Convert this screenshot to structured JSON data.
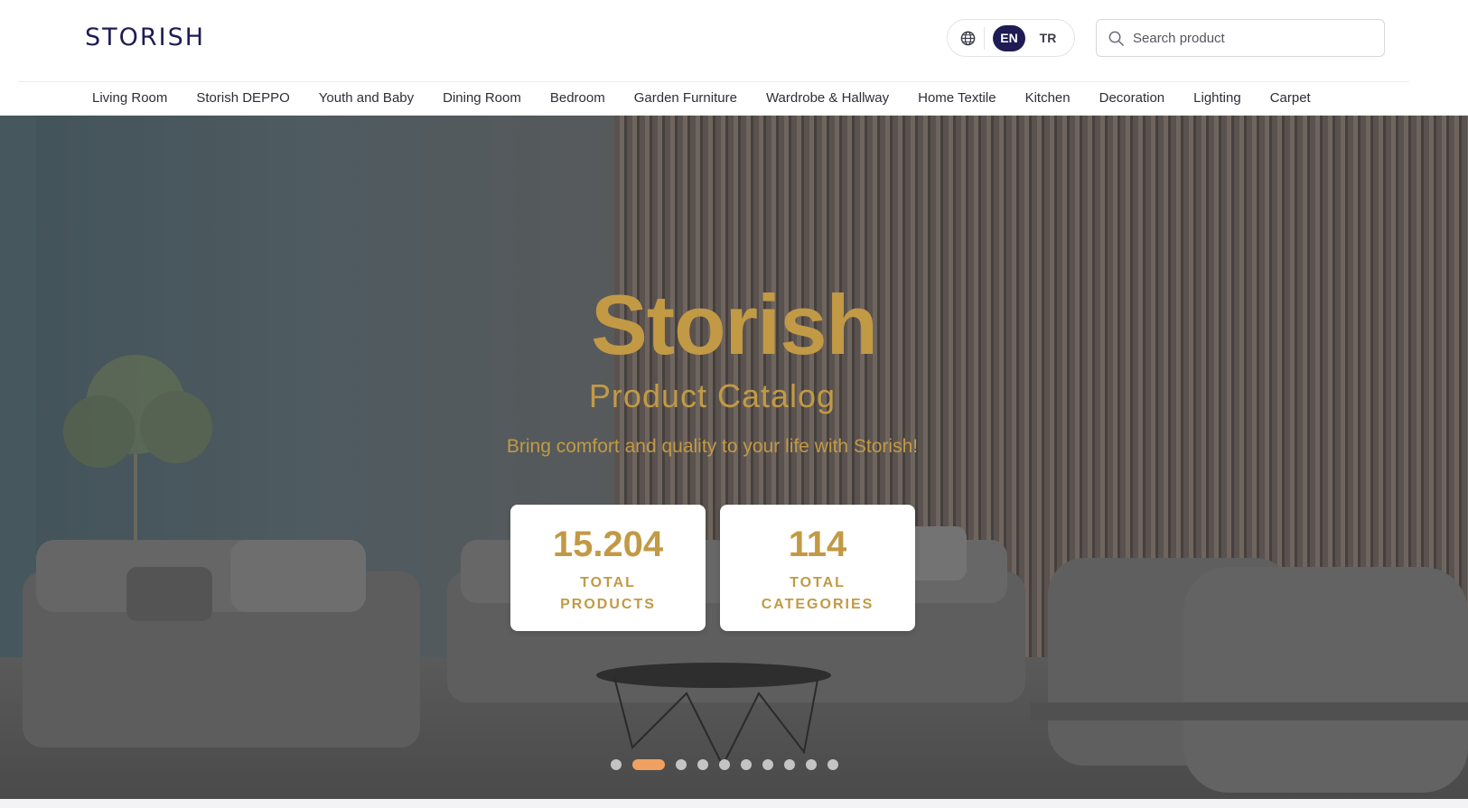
{
  "header": {
    "logo": "STORISH",
    "lang": {
      "globe_icon": "globe-icon",
      "options": [
        "EN",
        "TR"
      ],
      "active": "EN"
    },
    "search": {
      "placeholder": "Search product",
      "value": "",
      "icon": "search-icon"
    }
  },
  "nav": {
    "items": [
      "Living Room",
      "Storish DEPPO",
      "Youth and Baby",
      "Dining Room",
      "Bedroom",
      "Garden Furniture",
      "Wardrobe & Hallway",
      "Home Textile",
      "Kitchen",
      "Decoration",
      "Lighting",
      "Carpet"
    ]
  },
  "hero": {
    "title": "Storish",
    "subtitle": "Product Catalog",
    "tagline": "Bring comfort and quality to your life with Storish!",
    "stats": [
      {
        "value": "15.204",
        "label": "TOTAL PRODUCTS"
      },
      {
        "value": "114",
        "label": "TOTAL CATEGORIES"
      }
    ],
    "slides": {
      "count": 10,
      "active": 2
    }
  },
  "colors": {
    "brand": "#1f1b54",
    "accent": "#c29a45",
    "dot_active": "#f0a060"
  }
}
